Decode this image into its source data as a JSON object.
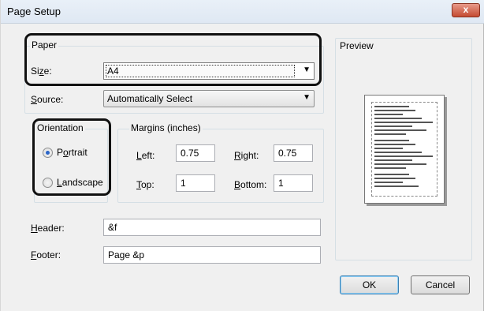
{
  "window": {
    "title": "Page Setup",
    "close_glyph": "x"
  },
  "paper": {
    "group_label": "Paper",
    "size_label_pre": "Si",
    "size_label_key": "z",
    "size_label_post": "e:",
    "size_value": "A4",
    "source_label_key": "S",
    "source_label_post": "ource:",
    "source_value": "Automatically Select"
  },
  "orientation": {
    "group_label": "Orientation",
    "portrait_pre": "P",
    "portrait_key": "o",
    "portrait_post": "rtrait",
    "landscape_key": "L",
    "landscape_post": "andscape",
    "selected": "portrait"
  },
  "margins": {
    "group_label": "Margins (inches)",
    "left_key": "L",
    "left_post": "eft:",
    "left_value": "0.75",
    "right_key": "R",
    "right_post": "ight:",
    "right_value": "0.75",
    "top_key": "T",
    "top_post": "op:",
    "top_value": "1",
    "bottom_key": "B",
    "bottom_post": "ottom:",
    "bottom_value": "1"
  },
  "header": {
    "label_key": "H",
    "label_post": "eader:",
    "value": "&f"
  },
  "footer": {
    "label_key": "F",
    "label_post": "ooter:",
    "value": "Page &p"
  },
  "preview": {
    "label": "Preview"
  },
  "buttons": {
    "ok": "OK",
    "cancel": "Cancel"
  },
  "colors": {
    "highlight_border": "#111111",
    "radio_dot": "#2b66c8",
    "close_button": "#c44b32"
  }
}
